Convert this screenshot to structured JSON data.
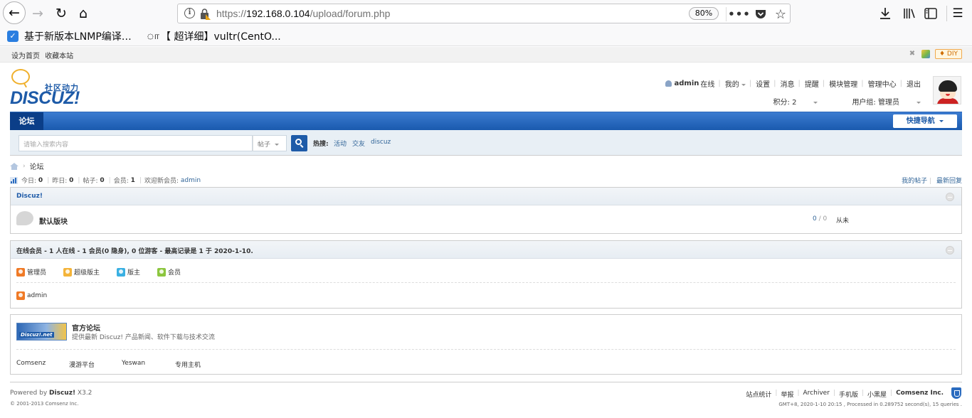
{
  "browser": {
    "url_prefix": "https://",
    "url_host": "192.168.0.104",
    "url_path": "/upload/forum.php",
    "zoom": "80%",
    "bookmarks": [
      {
        "label": "基于新版本LNMP编译…",
        "icon": "blue-feather-icon"
      },
      {
        "label": "【 超详细】vultr(CentO...",
        "icon": "script-icon"
      }
    ]
  },
  "topbar": {
    "links": [
      "设为首页",
      "收藏本站"
    ],
    "diy_label": "DIY"
  },
  "logo": {
    "slogan": "社区动力",
    "text": "DISCUZ!"
  },
  "user": {
    "name": "admin",
    "status": "在线",
    "menu": [
      "我的",
      "设置",
      "消息",
      "提醒",
      "模块管理",
      "管理中心",
      "退出"
    ],
    "points": "积分: 2",
    "group": "用户组: 管理员"
  },
  "nav": {
    "forum_tab": "论坛",
    "quick_nav": "快捷导航"
  },
  "search": {
    "placeholder": "请输入搜索内容",
    "type": "帖子",
    "hot_label": "热搜:",
    "hot_links": [
      "活动",
      "交友",
      "discuz"
    ]
  },
  "breadcrumb": {
    "current": "论坛"
  },
  "stats": {
    "today_label": "今日:",
    "today": "0",
    "yesterday_label": "昨日:",
    "yesterday": "0",
    "posts_label": "帖子:",
    "posts": "0",
    "members_label": "会员:",
    "members": "1",
    "welcome_label": "欢迎新会员:",
    "newest_member": "admin",
    "my_posts": "我的帖子",
    "latest_replies": "最新回复"
  },
  "forum_category": {
    "title": "Discuz!",
    "forums": [
      {
        "name": "默认版块",
        "threads": "0",
        "posts": "0",
        "last_post": "从未"
      }
    ]
  },
  "online": {
    "title": "在线会员 - 1 人在线 - 1 会员(0 隐身), 0 位游客 - 最高记录是 1 于 2020-1-10.",
    "legend": [
      "管理员",
      "超级版主",
      "版主",
      "会员"
    ],
    "users": [
      "admin"
    ]
  },
  "links": {
    "banner_text": "Discuz!.net",
    "title": "官方论坛",
    "description": "提供最新 Discuz! 产品新闻、软件下载与技术交流",
    "friends": [
      "Comsenz",
      "漫游平台",
      "Yeswan",
      "专用主机"
    ]
  },
  "footer": {
    "powered_prefix": "Powered by",
    "powered_name": "Discuz!",
    "version": "X3.2",
    "copyright": "© 2001-2013 Comsenz Inc.",
    "links": [
      "站点统计",
      "举报",
      "Archiver",
      "手机版",
      "小黑屋"
    ],
    "company": "Comsenz Inc.",
    "meta": "GMT+8, 2020-1-10 20:15 , Processed in 0.289752 second(s), 15 queries ."
  }
}
